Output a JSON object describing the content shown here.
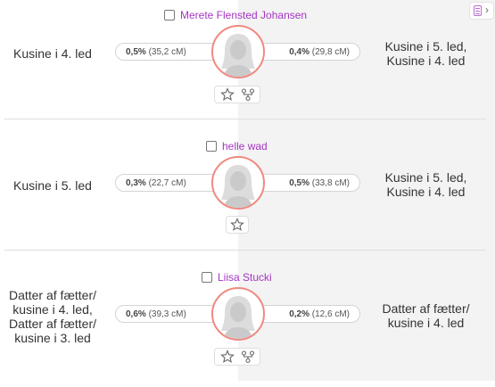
{
  "matches": [
    {
      "name": "Merete Flensted Johansen",
      "relationship_left": [
        "Kusine i 4. led"
      ],
      "dna_left_pct": "0,5%",
      "dna_left_cm": "(35,2 cM)",
      "dna_right_pct": "0,4%",
      "dna_right_cm": "(29,8 cM)",
      "relationship_right": [
        "Kusine i 5. led,",
        "Kusine i 4. led"
      ],
      "actions": [
        "star-icon",
        "tree-icon"
      ]
    },
    {
      "name": "helle wad",
      "relationship_left": [
        "Kusine i 5. led"
      ],
      "dna_left_pct": "0,3%",
      "dna_left_cm": "(22,7 cM)",
      "dna_right_pct": "0,5%",
      "dna_right_cm": "(33,8 cM)",
      "relationship_right": [
        "Kusine i 5. led,",
        "Kusine i 4. led"
      ],
      "actions": [
        "star-icon"
      ]
    },
    {
      "name": "Liisa Stucki",
      "relationship_left": [
        "Datter af fætter/",
        "kusine i 4. led,",
        "Datter af fætter/",
        "kusine i 3. led"
      ],
      "dna_left_pct": "0,6%",
      "dna_left_cm": "(39,3 cM)",
      "dna_right_pct": "0,2%",
      "dna_right_cm": "(12,6 cM)",
      "relationship_right": [
        "Datter af fætter/",
        "kusine i 4. led"
      ],
      "actions": [
        "star-icon",
        "tree-icon"
      ]
    }
  ],
  "colors": {
    "name_link": "#a535c4",
    "avatar_ring": "#ef8a82",
    "right_panel_bg": "#f3f3f3"
  }
}
